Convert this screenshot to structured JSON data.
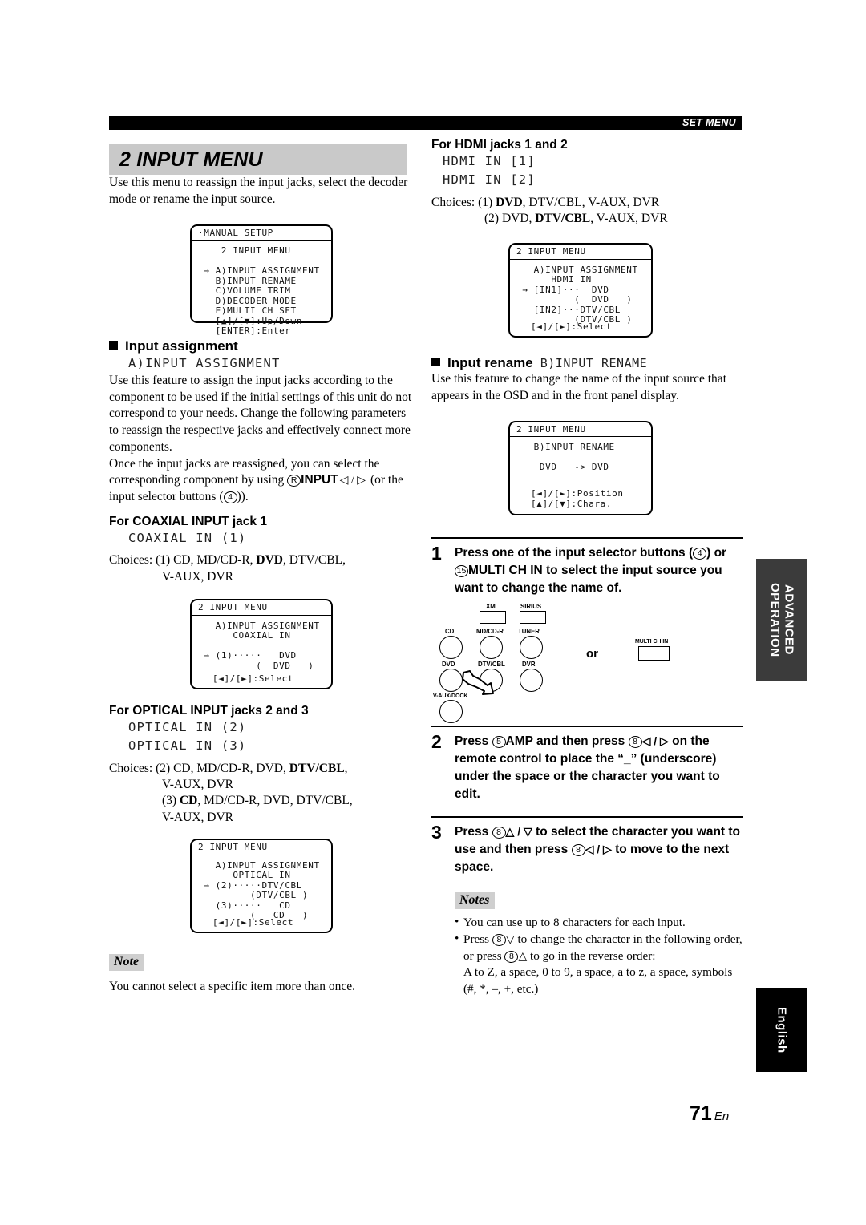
{
  "header": {
    "label": "SET MENU"
  },
  "page_number": {
    "number": "71",
    "suffix": "En"
  },
  "side_tabs": {
    "advanced": "ADVANCED\nOPERATION",
    "language": "English"
  },
  "left_column": {
    "section_title": "2 INPUT MENU",
    "intro": "Use this menu to reassign the input jacks, select the decoder mode or rename the input source.",
    "osd_manual_setup": {
      "title": "·MANUAL SETUP",
      "body": "    2 INPUT MENU\n\n → A)INPUT ASSIGNMENT\n   B)INPUT RENAME\n   C)VOLUME TRIM\n   D)DECODER MODE\n   E)MULTI CH SET\n   [▲]/[▼]:Up/Down\n   [ENTER]:Enter"
    },
    "input_assignment": {
      "heading": "Input assignment",
      "code": "A)INPUT ASSIGNMENT",
      "para1": "Use this feature to assign the input jacks according to the component to be used if the initial settings of this unit do not correspond to your needs. Change the following parameters to reassign the respective jacks and effectively connect more components.",
      "para2_a": "Once the input jacks are reassigned, you can select the corresponding component by using ",
      "para2_ref": "R",
      "para2_b": "INPUT",
      "para2_arrows": "◁ / ▷",
      "para2_c": " (or the input selector buttons (",
      "para2_ref2": "4",
      "para2_d": ")).",
      "coaxial": {
        "heading": "For COAXIAL INPUT jack 1",
        "code": "COAXIAL IN (1)",
        "choices_label": "Choices:",
        "choices_line1_pre": "(1) CD, MD/CD-R, ",
        "choices_line1_bold": "DVD",
        "choices_line1_post": ", DTV/CBL,",
        "choices_line2": "V-AUX, DVR"
      },
      "osd_coaxial": {
        "title": "2 INPUT MENU",
        "body": "   A)INPUT ASSIGNMENT\n      COAXIAL IN\n\n → (1)·····   DVD\n          (  DVD   )",
        "foot": "[◄]/[►]:Select"
      },
      "optical": {
        "heading": "For OPTICAL INPUT jacks 2 and 3",
        "code1": "OPTICAL IN (2)",
        "code2": "OPTICAL IN (3)",
        "choices_label": "Choices:",
        "choices_line1_pre": "(2) CD, MD/CD-R, DVD, ",
        "choices_line1_bold": "DTV/CBL",
        "choices_line1_post": ",",
        "choices_line2": "V-AUX, DVR",
        "choices_line3_pre": "(3) ",
        "choices_line3_bold": "CD",
        "choices_line3_post": ", MD/CD-R, DVD, DTV/CBL,",
        "choices_line4": "V-AUX, DVR"
      },
      "osd_optical": {
        "title": "2 INPUT MENU",
        "body": "   A)INPUT ASSIGNMENT\n      OPTICAL IN\n → (2)·····DTV/CBL\n         (DTV/CBL )\n   (3)·····   CD\n         (   CD   )",
        "foot": "[◄]/[►]:Select"
      }
    },
    "note": {
      "tag": "Note",
      "text": "You cannot select a specific item more than once."
    }
  },
  "right_column": {
    "hdmi": {
      "heading": "For HDMI jacks 1 and 2",
      "code1": "HDMI IN [1]",
      "code2": "HDMI IN [2]",
      "choices_label": "Choices:",
      "choices_line1_pre": "(1) ",
      "choices_line1_bold": "DVD",
      "choices_line1_post": ", DTV/CBL, V-AUX, DVR",
      "choices_line2_pre": "(2) DVD, ",
      "choices_line2_bold": "DTV/CBL",
      "choices_line2_post": ", V-AUX, DVR"
    },
    "osd_hdmi": {
      "title": "2 INPUT MENU",
      "body": "   A)INPUT ASSIGNMENT\n      HDMI IN\n → [IN1]···  DVD\n          (  DVD   )\n   [IN2]···DTV/CBL\n          (DTV/CBL )",
      "foot": "[◄]/[►]:Select"
    },
    "input_rename": {
      "heading": "Input rename",
      "code": "B)INPUT RENAME",
      "para": "Use this feature to change the name of the input source that appears in the OSD and in the front panel display."
    },
    "osd_rename": {
      "title": "2 INPUT MENU",
      "body": "   B)INPUT RENAME\n\n    DVD   -> DVD",
      "foot1": "[◄]/[►]:Position",
      "foot2": "[▲]/[▼]:Chara."
    },
    "steps": [
      {
        "num": "1",
        "text_parts": {
          "a": "Press one of the input selector buttons (",
          "ref1": "4",
          "b": ") or ",
          "ref2": "15",
          "c": "MULTI CH IN",
          "d": " to select the input source you want to change the name of."
        }
      },
      {
        "num": "2",
        "text_parts": {
          "a": "Press ",
          "ref1": "5",
          "b": "AMP",
          "c": " and then press ",
          "ref2": "8",
          "arrows": "◁ / ▷",
          "d": " on the remote control to place the “_” (underscore) under the space or the character you want to edit."
        }
      },
      {
        "num": "3",
        "text_parts": {
          "a": "Press ",
          "ref1": "8",
          "arrows1": "△ / ▽",
          "b": " to select the character you want to use and then press ",
          "ref2": "8",
          "arrows2": "◁ / ▷",
          "c": " to move to the next space."
        }
      }
    ],
    "button_diagram": {
      "or_label": "or",
      "buttons": [
        {
          "label": "XM",
          "shape": "rect"
        },
        {
          "label": "SIRIUS",
          "shape": "rect"
        },
        {
          "label": "CD",
          "shape": "circle"
        },
        {
          "label": "MD/CD-R",
          "shape": "circle"
        },
        {
          "label": "TUNER",
          "shape": "circle"
        },
        {
          "label": "DVD",
          "shape": "circle"
        },
        {
          "label": "DTV/CBL",
          "shape": "circle"
        },
        {
          "label": "DVR",
          "shape": "circle"
        },
        {
          "label": "V-AUX/DOCK",
          "shape": "circle"
        },
        {
          "label": "MULTI CH IN",
          "shape": "rect"
        }
      ]
    },
    "notes": {
      "tag": "Notes",
      "items": [
        "You can use up to 8 characters for each input.",
        "Press ⓪▽ to change the character in the following order, or press ⓪△ to go in the reverse order:"
      ],
      "item2_a": "Press ",
      "item2_ref": "8",
      "item2_arrow1": "▽",
      "item2_b": " to change the character in the following order, or press ",
      "item2_ref2": "8",
      "item2_arrow2": "△",
      "item2_c": " to go in the reverse order:",
      "order_line": "A to Z, a space, 0 to 9, a space, a to z, a space, symbols (#, *, –, +, etc.)"
    }
  }
}
